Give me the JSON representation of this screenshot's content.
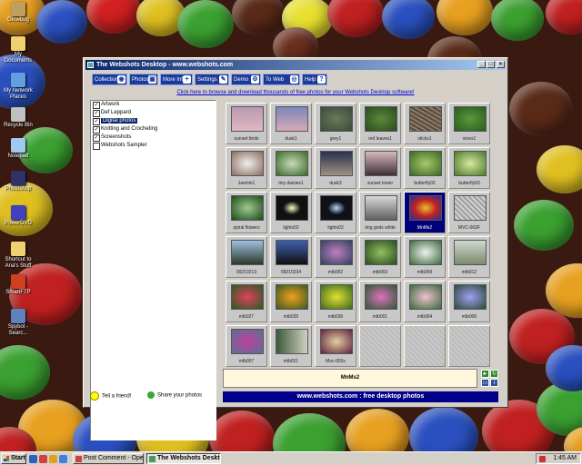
{
  "desktop_icons": [
    {
      "label": "Glowbug",
      "color": "#c0a060"
    },
    {
      "label": "My Documents",
      "color": "#f0d070"
    },
    {
      "label": "My Network Places",
      "color": "#60a0e0"
    },
    {
      "label": "Recycle Bin",
      "color": "#c0c0c0"
    },
    {
      "label": "Notepad",
      "color": "#a0c8f0"
    },
    {
      "label": "Photoshop",
      "color": "#30306a"
    },
    {
      "label": "PowerDVD",
      "color": "#4040c0"
    },
    {
      "label": "Shortcut to Ana's Stuff",
      "color": "#f0d070"
    },
    {
      "label": "SmartFTP",
      "color": "#d04020"
    },
    {
      "label": "Spybot - Searc...",
      "color": "#6080c0"
    }
  ],
  "window": {
    "title": "The Webshots Desktop - www.webshots.com",
    "controls": {
      "minimize": "_",
      "maximize": "□",
      "close": "×"
    }
  },
  "toolbar": [
    {
      "label": "Collections",
      "icon": "collections-icon",
      "glyph": "◉"
    },
    {
      "label": "Photos",
      "icon": "photos-icon",
      "glyph": "▣"
    },
    {
      "label": "More Info",
      "icon": "info-icon",
      "glyph": "+"
    },
    {
      "label": "Settings",
      "icon": "wrench-icon",
      "glyph": "✎"
    },
    {
      "label": "Demo",
      "icon": "demo-icon",
      "glyph": "⚙"
    },
    {
      "label": "To Web",
      "icon": "web-icon",
      "glyph": "◎"
    },
    {
      "label": "Help",
      "icon": "help-icon",
      "glyph": "?"
    }
  ],
  "promo_link": "Click here to browse and download thousands of free photos for your Webshots Desktop software!",
  "collections": [
    {
      "label": "Artwork",
      "checked": true,
      "selected": false
    },
    {
      "label": "Def Leppard",
      "checked": true,
      "selected": false
    },
    {
      "label": "Digital photos",
      "checked": true,
      "selected": true
    },
    {
      "label": "Knitting and Crocheting",
      "checked": true,
      "selected": false
    },
    {
      "label": "Screenshots",
      "checked": true,
      "selected": false
    },
    {
      "label": "Webshots Sampler",
      "checked": false,
      "selected": false
    }
  ],
  "photos": [
    {
      "caption": "sunset birds",
      "bg": "linear-gradient(#b89ab0,#e0b8c0)"
    },
    {
      "caption": "dusk1",
      "bg": "linear-gradient(#7a88b8,#d8a8b8)"
    },
    {
      "caption": "grey1",
      "bg": "radial-gradient(#6a7a5a,#3a4a3a)"
    },
    {
      "caption": "red leaves1",
      "bg": "radial-gradient(#5a8a3a,#2a4a20)"
    },
    {
      "caption": "sticks1",
      "bg": "repeating-linear-gradient(30deg,#8a7a6a 0 2px,#5a4a3a 2px 4px)"
    },
    {
      "caption": "vines1",
      "bg": "radial-gradient(#5a9a3a,#2a5a20)"
    },
    {
      "caption": "Jasmin1",
      "bg": "radial-gradient(#f0f0f0,#8a6a5a)"
    },
    {
      "caption": "tiny daisies1",
      "bg": "radial-gradient(#c8d8b8,#3a6a2a)"
    },
    {
      "caption": "dusk3",
      "bg": "linear-gradient(#2a3050,#a09080)"
    },
    {
      "caption": "sunset tower",
      "bg": "linear-gradient(#d8b8c0,#403038)"
    },
    {
      "caption": "butterfly02",
      "bg": "radial-gradient(#a8c870,#3a6a20)"
    },
    {
      "caption": "butterfly03",
      "bg": "radial-gradient(#d8e8a0,#4a7a2a)"
    },
    {
      "caption": "spiral flowers",
      "bg": "radial-gradient(#a0c890,#1a4a1a)"
    },
    {
      "caption": "lights02",
      "bg": "radial-gradient(#e0e0a0 5%,#101010 40%)"
    },
    {
      "caption": "lights03",
      "bg": "radial-gradient(#a0c0e0 5%,#101018 40%)"
    },
    {
      "caption": "dog gods white",
      "bg": "linear-gradient(#d8d8d8,#606060)"
    },
    {
      "caption": "MnMs2",
      "bg": "radial-gradient(#e0c030,#c02020,#2030a0)"
    },
    {
      "caption": "MVC-002F",
      "bg": "repeating-linear-gradient(45deg,#a0a0a0 0 2px,#d0d0d0 2px 4px)"
    },
    {
      "caption": "09210213",
      "bg": "linear-gradient(#a0c0e0,#2a3a2a)"
    },
    {
      "caption": "09210234",
      "bg": "linear-gradient(#4060b0,#101010)"
    },
    {
      "caption": "mlb002",
      "bg": "radial-gradient(#c080c0,#304060)"
    },
    {
      "caption": "mlb003",
      "bg": "radial-gradient(#90c060,#2a4a20)"
    },
    {
      "caption": "mlb009",
      "bg": "radial-gradient(#f0f0f0,#3a6a3a)"
    },
    {
      "caption": "mlb012",
      "bg": "linear-gradient(#d0d8d0,#7a8a6a)"
    },
    {
      "caption": "mlb027",
      "bg": "radial-gradient(#e04060,#2a5a20)"
    },
    {
      "caption": "mlb035",
      "bg": "radial-gradient(#f0a020,#3a5a20)"
    },
    {
      "caption": "mlb036",
      "bg": "radial-gradient(#e0e030,#3a6a20)"
    },
    {
      "caption": "mlb001",
      "bg": "radial-gradient(#e070c0,#2a5a30)"
    },
    {
      "caption": "mlb004",
      "bg": "radial-gradient(#f0c0d0,#3a6a3a)"
    },
    {
      "caption": "mlb006",
      "bg": "radial-gradient(#a0a0f0,#2a4a3a)"
    },
    {
      "caption": "mlb007",
      "bg": "radial-gradient(#c040a0,#5a7090)"
    },
    {
      "caption": "mlb021",
      "bg": "linear-gradient(90deg,#3a5a3a,#d0d0c0)"
    },
    {
      "caption": "Mvc-003s",
      "bg": "radial-gradient(#e0d0a0,#602040)"
    },
    {
      "caption": "",
      "bg": ""
    },
    {
      "caption": "",
      "bg": ""
    },
    {
      "caption": "",
      "bg": ""
    }
  ],
  "selected_photo_name": "MnMs2",
  "tell_friend": "Tell a friend!",
  "share_photos": "Share your photos",
  "banner_text": "www.webshots.com :  free desktop photos",
  "taskbar": {
    "start": "Start",
    "tasks": [
      {
        "label": "Post Comment - Opera",
        "active": false
      },
      {
        "label": "The Webshots Deskto...",
        "active": true
      }
    ],
    "clock": "1:45 AM"
  }
}
